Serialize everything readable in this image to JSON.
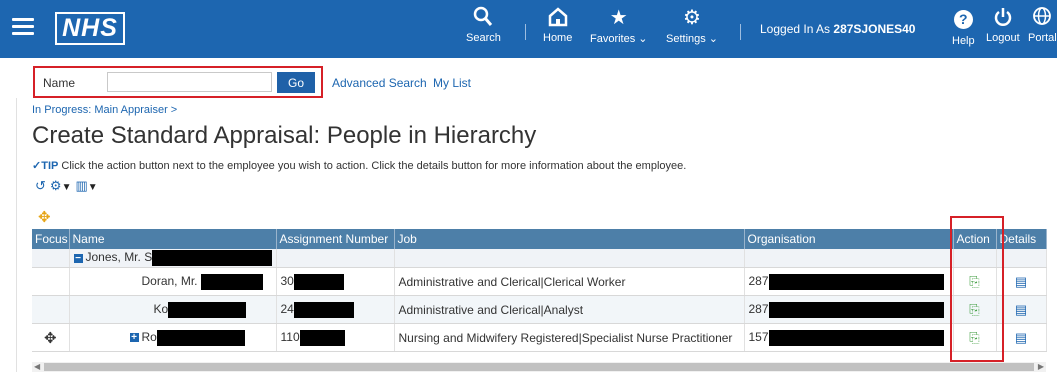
{
  "header": {
    "logo": "NHS",
    "nav": [
      {
        "icon": "search-icon",
        "glyph": "🔍",
        "label": "Search"
      },
      {
        "icon": "home-icon",
        "glyph": "⌂",
        "label": "Home"
      },
      {
        "icon": "star-icon",
        "glyph": "★",
        "label": "Favorites ⌄"
      },
      {
        "icon": "gear-icon",
        "glyph": "⚙",
        "label": "Settings ⌄"
      }
    ],
    "logged_in_prefix": "Logged In As",
    "logged_in_user": "287SJONES40",
    "help_label": "Help",
    "logout_label": "Logout",
    "portal_label": "Portal"
  },
  "search": {
    "label": "Name",
    "value": "",
    "placeholder": "",
    "go_label": "Go",
    "advanced_search": "Advanced Search",
    "my_list": "My List"
  },
  "breadcrumb": "In Progress: Main Appraiser >",
  "page_title": "Create Standard Appraisal: People in Hierarchy",
  "tip": {
    "label": "TIP",
    "text": " Click the action button next to the employee you wish to action. Click the details button for more information about the employee."
  },
  "table": {
    "columns": [
      "Focus",
      "Name",
      "Assignment Number",
      "Job",
      "Organisation",
      "Action",
      "Details"
    ],
    "group_row": {
      "name": "Jones, Mr. S"
    },
    "rows": [
      {
        "name": "Doran, Mr.",
        "assignment": "30",
        "job": "Administrative and Clerical|Clerical Worker",
        "organisation": "287"
      },
      {
        "name": "Ko",
        "assignment": "24",
        "job": "Administrative and Clerical|Analyst",
        "organisation": "287"
      },
      {
        "name": "Ro",
        "assignment": "110",
        "job": "Nursing and Midwifery Registered|Specialist Nurse Practitioner",
        "organisation": "157"
      }
    ]
  },
  "colors": {
    "header": "#1d66b0",
    "highlight": "#d62027",
    "table_header": "#4d7fa8"
  }
}
